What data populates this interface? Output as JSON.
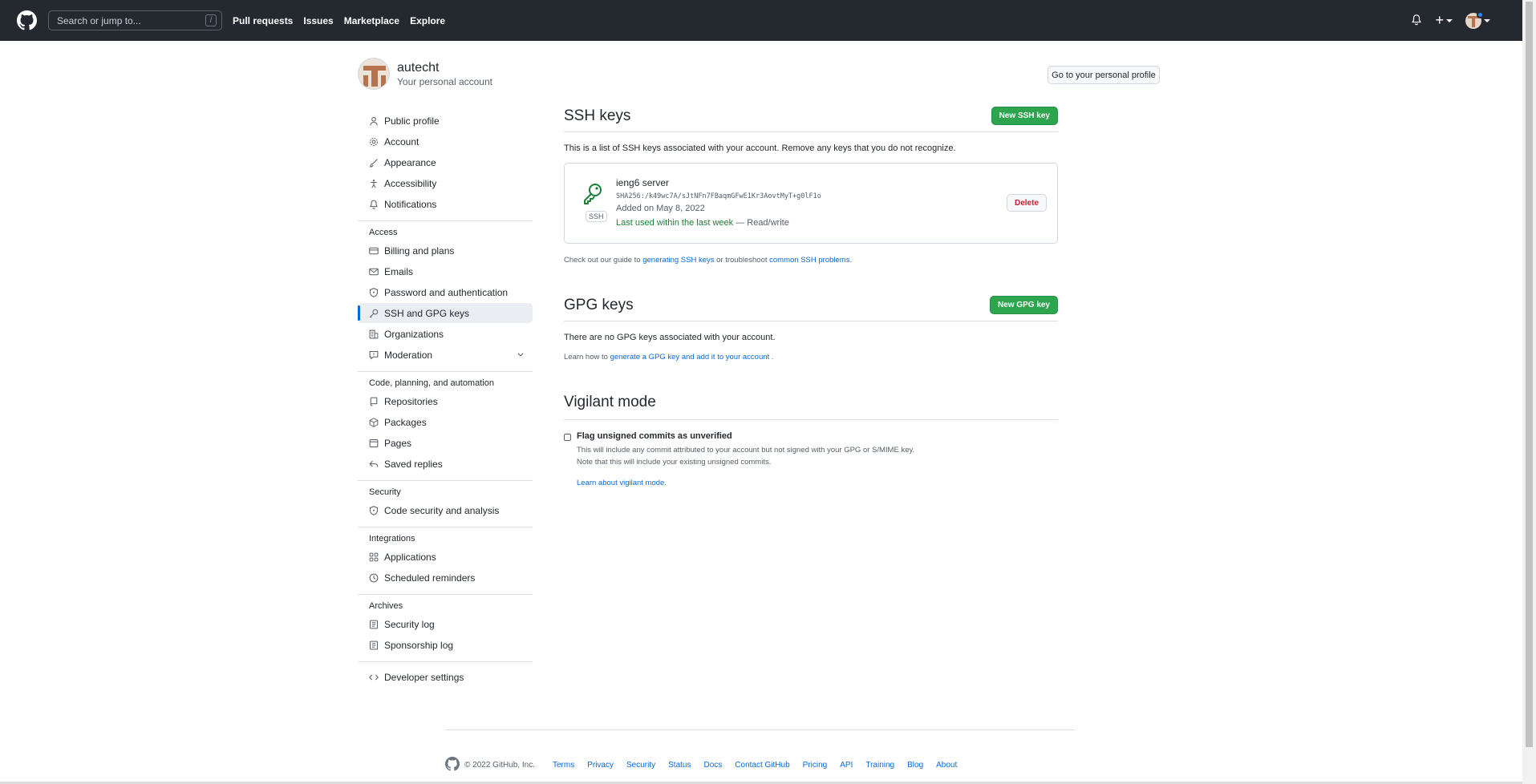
{
  "header": {
    "search_placeholder": "Search or jump to...",
    "search_shortcut": "/",
    "nav": [
      "Pull requests",
      "Issues",
      "Marketplace",
      "Explore"
    ],
    "plus": "+"
  },
  "account": {
    "name": "autecht",
    "subtitle": "Your personal account",
    "profile_button": "Go to your personal profile"
  },
  "sidebar": {
    "group1": [
      "Public profile",
      "Account",
      "Appearance",
      "Accessibility",
      "Notifications"
    ],
    "access_heading": "Access",
    "access": [
      "Billing and plans",
      "Emails",
      "Password and authentication",
      "SSH and GPG keys",
      "Organizations",
      "Moderation"
    ],
    "code_heading": "Code, planning, and automation",
    "code": [
      "Repositories",
      "Packages",
      "Pages",
      "Saved replies"
    ],
    "security_heading": "Security",
    "security": [
      "Code security and analysis"
    ],
    "integrations_heading": "Integrations",
    "integrations": [
      "Applications",
      "Scheduled reminders"
    ],
    "archives_heading": "Archives",
    "archives": [
      "Security log",
      "Sponsorship log"
    ],
    "developer": "Developer settings"
  },
  "ssh": {
    "title": "SSH keys",
    "new_button": "New SSH key",
    "description": "This is a list of SSH keys associated with your account. Remove any keys that you do not recognize.",
    "key": {
      "title": "ieng6 server",
      "fingerprint": "SHA256:/k49wc7A/sJtNFn7FBaqmGFwE1Kr3AovtMyT+g0lF1o",
      "added": "Added on May 8, 2022",
      "last_used": "Last used within the last week",
      "access": " — Read/write",
      "label": "SSH",
      "delete": "Delete"
    },
    "note_prefix": "Check out our guide to ",
    "note_link1": "generating SSH keys",
    "note_middle": " or troubleshoot ",
    "note_link2": "common SSH problems",
    "note_suffix": "."
  },
  "gpg": {
    "title": "GPG keys",
    "new_button": "New GPG key",
    "none": "There are no GPG keys associated with your account.",
    "learn_prefix": "Learn how to ",
    "learn_link": "generate a GPG key and add it to your account",
    "learn_suffix": " ."
  },
  "vigilant": {
    "title": "Vigilant mode",
    "checkbox_label": "Flag unsigned commits as unverified",
    "note1": "This will include any commit attributed to your account but not signed with your GPG or S/MIME key.",
    "note2": "Note that this will include your existing unsigned commits.",
    "learn": "Learn about vigilant mode."
  },
  "footer": {
    "copyright": "© 2022 GitHub, Inc.",
    "links": [
      "Terms",
      "Privacy",
      "Security",
      "Status",
      "Docs",
      "Contact GitHub",
      "Pricing",
      "API",
      "Training",
      "Blog",
      "About"
    ]
  },
  "colors": {
    "header_bg": "#24292f",
    "green": "#2da44e",
    "link": "#0969da",
    "danger": "#cf222e"
  }
}
